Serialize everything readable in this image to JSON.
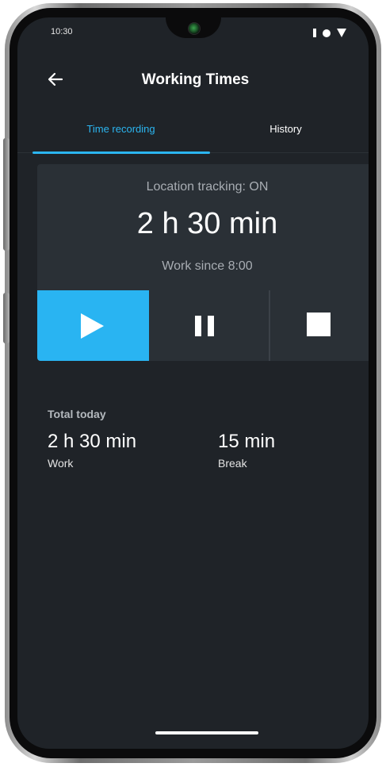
{
  "status_bar": {
    "time": "10:30"
  },
  "app_bar": {
    "title": "Working Times"
  },
  "tabs": [
    {
      "label": "Time recording",
      "active": true
    },
    {
      "label": "History",
      "active": false
    }
  ],
  "tracker": {
    "location_status": "Location tracking: ON",
    "elapsed": "2 h 30 min",
    "since": "Work since 8:00",
    "active_control": "play"
  },
  "summary": {
    "heading": "Total today",
    "work": {
      "value": "2 h 30 min",
      "label": "Work"
    },
    "break": {
      "value": "15 min",
      "label": "Break"
    }
  },
  "colors": {
    "accent": "#29b4f2",
    "background": "#1f2328",
    "card": "#2a3036"
  },
  "icons": {
    "back": "arrow-left-icon",
    "play": "play-icon",
    "pause": "pause-icon",
    "stop": "stop-icon"
  }
}
